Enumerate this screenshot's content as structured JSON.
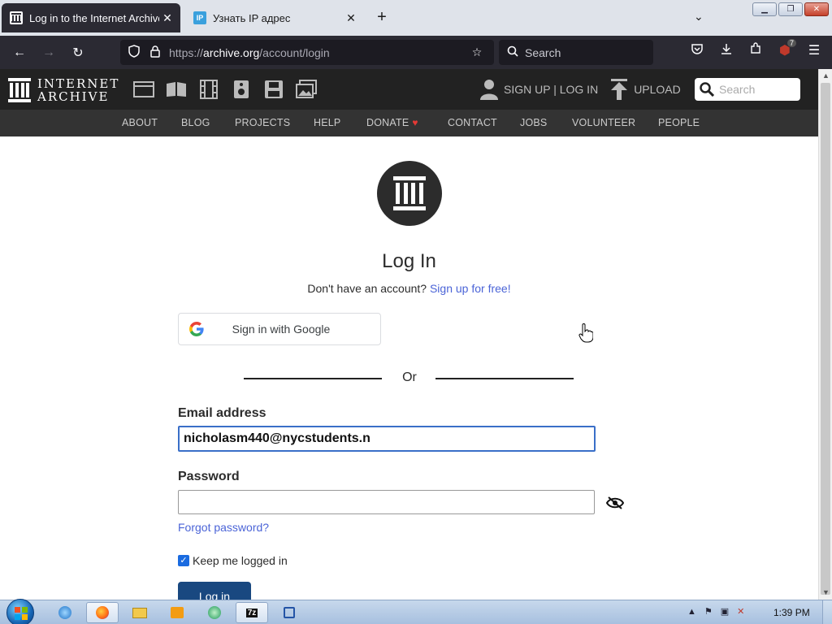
{
  "browser": {
    "tabs": [
      {
        "title": "Log in to the Internet Archive",
        "favicon": "archive-icon",
        "active": true
      },
      {
        "title": "Узнать IP адрес",
        "favicon": "IP",
        "active": false
      }
    ],
    "new_tab": "+",
    "tab_list": "⌄",
    "url_host": "archive.org",
    "url_scheme": "https://",
    "url_path": "/account/login",
    "search_placeholder": "Search",
    "extension_badge": "7",
    "window_buttons": [
      "minimize",
      "restore",
      "close"
    ]
  },
  "archive_header": {
    "wordmark_line1": "INTERNET",
    "wordmark_line2": "ARCHIVE",
    "media_icons": [
      "web-icon",
      "texts-icon",
      "video-icon",
      "audio-icon",
      "software-icon",
      "images-icon"
    ],
    "signup_login": "SIGN UP | LOG IN",
    "upload": "UPLOAD",
    "search_placeholder": "Search",
    "nav": [
      "ABOUT",
      "BLOG",
      "PROJECTS",
      "HELP",
      "DONATE",
      "CONTACT",
      "JOBS",
      "VOLUNTEER",
      "PEOPLE"
    ]
  },
  "login": {
    "title": "Log In",
    "no_account": "Don't have an account?",
    "signup_link": "Sign up for free!",
    "google_button": "Sign in with Google",
    "or": "Or",
    "email_label": "Email address",
    "email_value": "nicholasm440@nycstudents.n",
    "password_label": "Password",
    "password_value": "",
    "forgot_password": "Forgot password?",
    "keep_logged_in": "Keep me logged in",
    "keep_logged_in_checked": true,
    "login_button": "Log in"
  },
  "taskbar": {
    "clock": "1:39 PM",
    "apps": [
      "ie-icon",
      "firefox-icon",
      "explorer-icon",
      "media-player-icon",
      "network-icon",
      "7zip-icon",
      "app-icon"
    ]
  },
  "colors": {
    "accent_link": "#4b64d7",
    "login_button": "#194880",
    "header_bg": "#222222",
    "subnav_bg": "#333333",
    "browser_chrome": "#2b2a33"
  }
}
